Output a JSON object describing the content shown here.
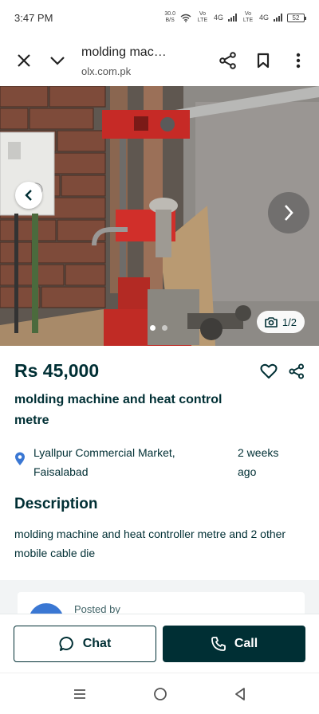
{
  "status_bar": {
    "time": "3:47 PM",
    "data_rate": "30.0",
    "data_unit": "B/S",
    "net1": "Vo LTE",
    "net1_type": "4G",
    "net2": "Vo LTE",
    "net2_type": "4G",
    "battery": "52"
  },
  "browser": {
    "page_title": "molding mac…",
    "domain": "olx.com.pk"
  },
  "gallery": {
    "counter": "1/2",
    "active_dot": 0,
    "dot_count": 2
  },
  "listing": {
    "price": "Rs 45,000",
    "title": "molding machine and heat control metre",
    "location": "Lyallpur Commercial Market, Faisalabad",
    "posted_time": "2 weeks ago",
    "description_heading": "Description",
    "description": "molding machine and heat controller metre and 2 other mobile cable die"
  },
  "seller": {
    "posted_by": "Posted by"
  },
  "actions": {
    "chat_label": "Chat",
    "call_label": "Call"
  },
  "colors": {
    "brand_dark": "#002f34",
    "accent_blue": "#3a77d3",
    "machine_red": "#c62a26"
  },
  "icons": {
    "close": "close-icon",
    "chevron": "chevron-down-icon",
    "share": "share-icon",
    "bookmark": "bookmark-icon",
    "more": "more-vertical-icon",
    "heart": "heart-icon",
    "location": "location-pin-icon",
    "camera": "camera-icon",
    "chat": "chat-bubble-icon",
    "phone": "phone-icon"
  }
}
